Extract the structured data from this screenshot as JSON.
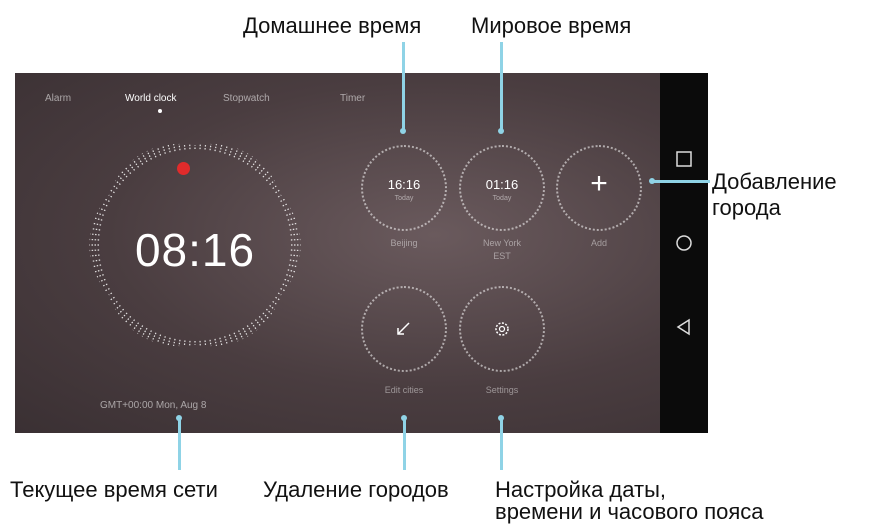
{
  "callouts": {
    "home_time": "Домашнее время",
    "world_time": "Мировое время",
    "add_city_1": "Добавление",
    "add_city_2": "города",
    "network_time": "Текущее время сети",
    "delete_cities": "Удаление городов",
    "settings_1": "Настройка даты,",
    "settings_2": "времени и часового пояса"
  },
  "screen": {
    "tabs": [
      "Alarm",
      "World clock",
      "Stopwatch",
      "Timer"
    ],
    "main_clock": {
      "time": "08:16",
      "gmt": "GMT+00:00 Mon, Aug 8"
    },
    "cities": [
      {
        "time": "16:16",
        "sub": "Today",
        "label": "Beijing"
      },
      {
        "time": "01:16",
        "sub": "Today",
        "label": "New York",
        "label2": "EST"
      }
    ],
    "add_label": "Add",
    "edit_label": "Edit cities",
    "settings_label": "Settings"
  },
  "colors": {
    "callout_line": "#8fd3e6",
    "accent_red": "#e02b2b"
  },
  "icons": [
    "plus-icon",
    "edit-icon",
    "gear-icon",
    "square-nav-icon",
    "circle-nav-icon",
    "back-nav-icon"
  ]
}
